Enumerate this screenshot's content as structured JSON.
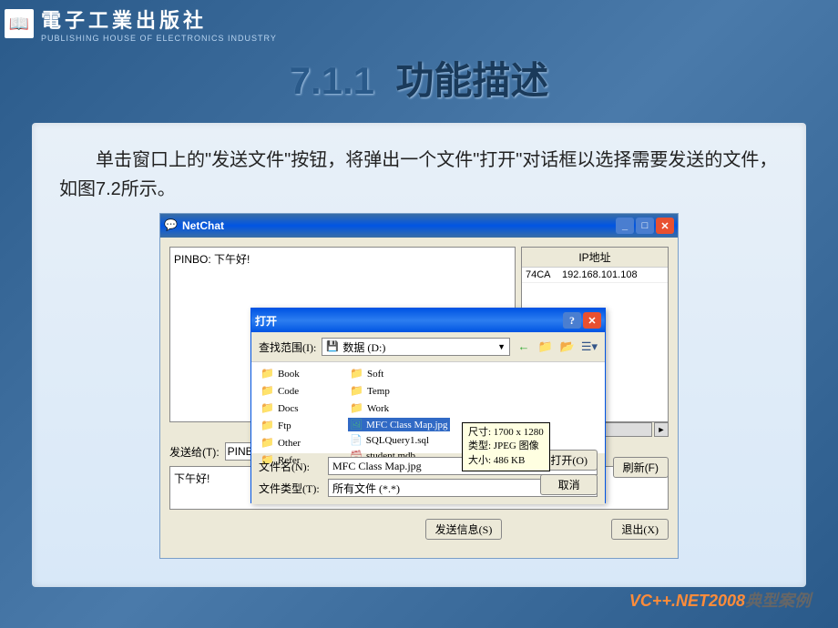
{
  "publisher": {
    "name_cn": "電子工業出版社",
    "name_en": "PUBLISHING HOUSE OF ELECTRONICS INDUSTRY"
  },
  "page": {
    "title_num": "7.1.1",
    "title_text": "功能描述",
    "body_text": "单击窗口上的\"发送文件\"按钮，将弹出一个文件\"打开\"对话框以选择需要发送的文件，如图7.2所示。"
  },
  "footer": {
    "product": "VC++.NET2008",
    "suffix": "典型案例"
  },
  "netchat": {
    "title": "NetChat",
    "chat_log": "PINBO: 下午好!",
    "ip_header": "IP地址",
    "ip_list": [
      {
        "host": "74CA",
        "ip": "192.168.101.108"
      }
    ],
    "send_to_label": "发送给(T):",
    "send_to_value": "PINB",
    "message_value": "下午好!",
    "send_button": "发送信息(S)",
    "exit_button": "退出(X)",
    "refresh_button": "刷新(F)"
  },
  "open_dialog": {
    "title": "打开",
    "look_in_label": "查找范围(I):",
    "look_in_value": "数据 (D:)",
    "folders_col1": [
      "Book",
      "Code",
      "Docs",
      "Ftp",
      "Other",
      "Refer"
    ],
    "folders_col2": [
      "Soft",
      "Temp",
      "Work"
    ],
    "files": [
      {
        "name": "MFC Class Map.jpg",
        "type": "img",
        "selected": true
      },
      {
        "name": "SQLQuery1.sql",
        "type": "sql",
        "selected": false
      },
      {
        "name": "student.mdb",
        "type": "mdb",
        "selected": false
      }
    ],
    "filename_label": "文件名(N):",
    "filename_value": "MFC Class Map.jpg",
    "filetype_label": "文件类型(T):",
    "filetype_value": "所有文件 (*.*)",
    "open_button": "打开(O)",
    "cancel_button": "取消"
  },
  "tooltip": {
    "line1": "尺寸: 1700 x 1280",
    "line2": "类型: JPEG 图像",
    "line3": "大小: 486 KB"
  }
}
